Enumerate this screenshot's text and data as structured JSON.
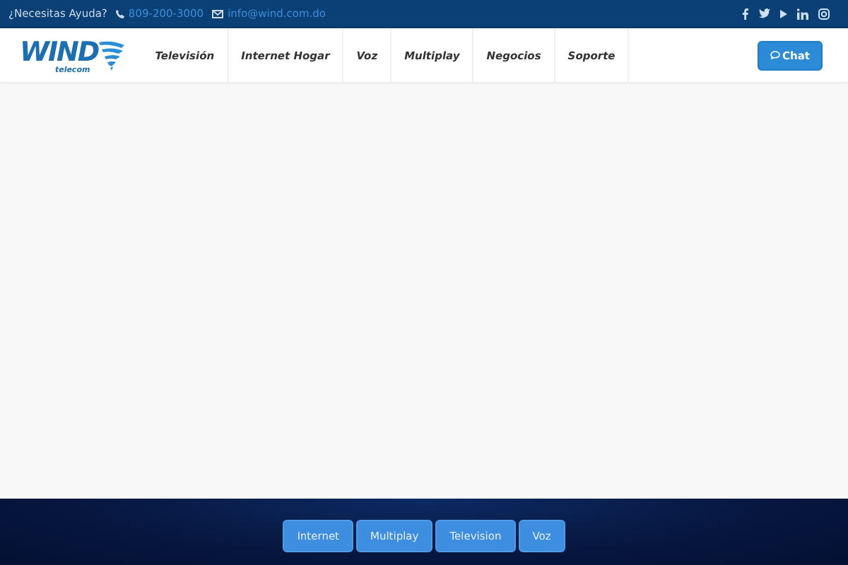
{
  "top_bar": {
    "help_text": "¿Necesitas Ayuda?",
    "phone": "809-200-3000",
    "email": "info@wind.com.do"
  },
  "logo": {
    "name": "WIND",
    "tagline": "telecom"
  },
  "nav": [
    "Televisión",
    "Internet Hogar",
    "Voz",
    "Multiplay",
    "Negocios",
    "Soporte"
  ],
  "chat_button": "Chat",
  "tabs": [
    {
      "label": "Internet",
      "selected": false
    },
    {
      "label": "Multiplay",
      "selected": false
    },
    {
      "label": "Television",
      "selected": false
    },
    {
      "label": "Voz",
      "selected": false
    }
  ]
}
